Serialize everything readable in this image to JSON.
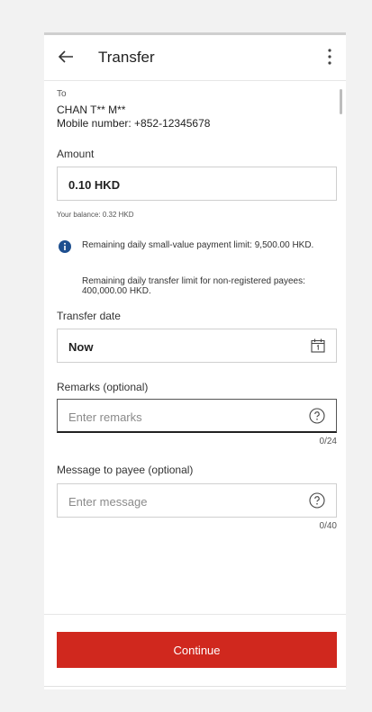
{
  "header": {
    "title": "Transfer"
  },
  "payee": {
    "to_label": "To",
    "name": "CHAN T** M**",
    "mobile": "Mobile number: +852-12345678"
  },
  "amount": {
    "label": "Amount",
    "value": "0.10 HKD",
    "balance": "Your balance: 0.32 HKD"
  },
  "limits": {
    "small_value": "Remaining daily small-value payment limit: 9,500.00 HKD.",
    "non_registered": "Remaining daily transfer limit for non-registered payees: 400,000.00 HKD."
  },
  "transfer_date": {
    "label": "Transfer date",
    "value": "Now"
  },
  "remarks": {
    "label": "Remarks (optional)",
    "placeholder": "Enter remarks",
    "counter": "0/24"
  },
  "message": {
    "label": "Message to payee (optional)",
    "placeholder": "Enter message",
    "counter": "0/40"
  },
  "actions": {
    "continue_label": "Continue"
  },
  "colors": {
    "accent": "#d0281e",
    "info": "#1e4f8f"
  }
}
